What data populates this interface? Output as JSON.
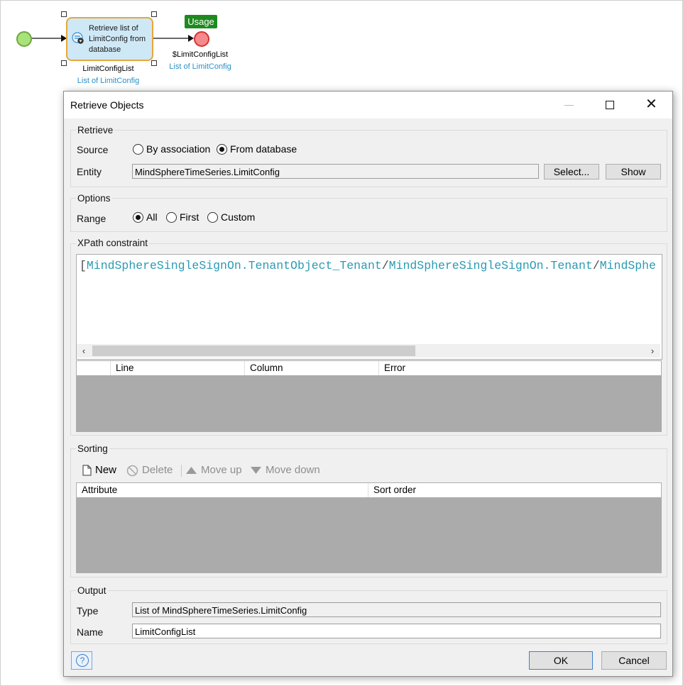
{
  "microflow": {
    "activity_text": "Retrieve list of LimitConfig from database",
    "activity_output_name": "LimitConfigList",
    "activity_output_type": "List of LimitConfig",
    "usage_badge": "Usage",
    "end_return_name": "$LimitConfigList",
    "end_return_type": "List of LimitConfig",
    "icons": {
      "start": "start-event-circle",
      "end": "end-event-circle",
      "activity": "retrieve-database-icon"
    },
    "colors": {
      "start": "#a9e27a",
      "end": "#f58a8a",
      "activity_bg": "#cfe8f6",
      "activity_border": "#e8a73a",
      "usage": "#1e8a1e",
      "type_text": "#2a8fc9"
    }
  },
  "dialog": {
    "title": "Retrieve Objects",
    "retrieve": {
      "group_label": "Retrieve",
      "source_label": "Source",
      "source_options": [
        "By association",
        "From database"
      ],
      "source_selected": "From database",
      "entity_label": "Entity",
      "entity_value": "MindSphereTimeSeries.LimitConfig",
      "select_button": "Select...",
      "show_button": "Show"
    },
    "options": {
      "group_label": "Options",
      "range_label": "Range",
      "range_options": [
        "All",
        "First",
        "Custom"
      ],
      "range_selected": "All"
    },
    "xpath": {
      "group_label": "XPath constraint",
      "open_bracket": "[",
      "seg1": "MindSphereSingleSignOn.TenantObject_Tenant",
      "slash1": "/",
      "seg2": "MindSphereSingleSignOn.Tenant",
      "slash2": "/",
      "seg3": "MindSphe",
      "error_columns": [
        "",
        "Line",
        "Column",
        "Error"
      ]
    },
    "sorting": {
      "group_label": "Sorting",
      "toolbar": {
        "new": "New",
        "delete": "Delete",
        "move_up": "Move up",
        "move_down": "Move down"
      },
      "columns": [
        "Attribute",
        "Sort order"
      ]
    },
    "output": {
      "group_label": "Output",
      "type_label": "Type",
      "type_value": "List of MindSphereTimeSeries.LimitConfig",
      "name_label": "Name",
      "name_value": "LimitConfigList"
    },
    "buttons": {
      "ok": "OK",
      "cancel": "Cancel"
    }
  }
}
